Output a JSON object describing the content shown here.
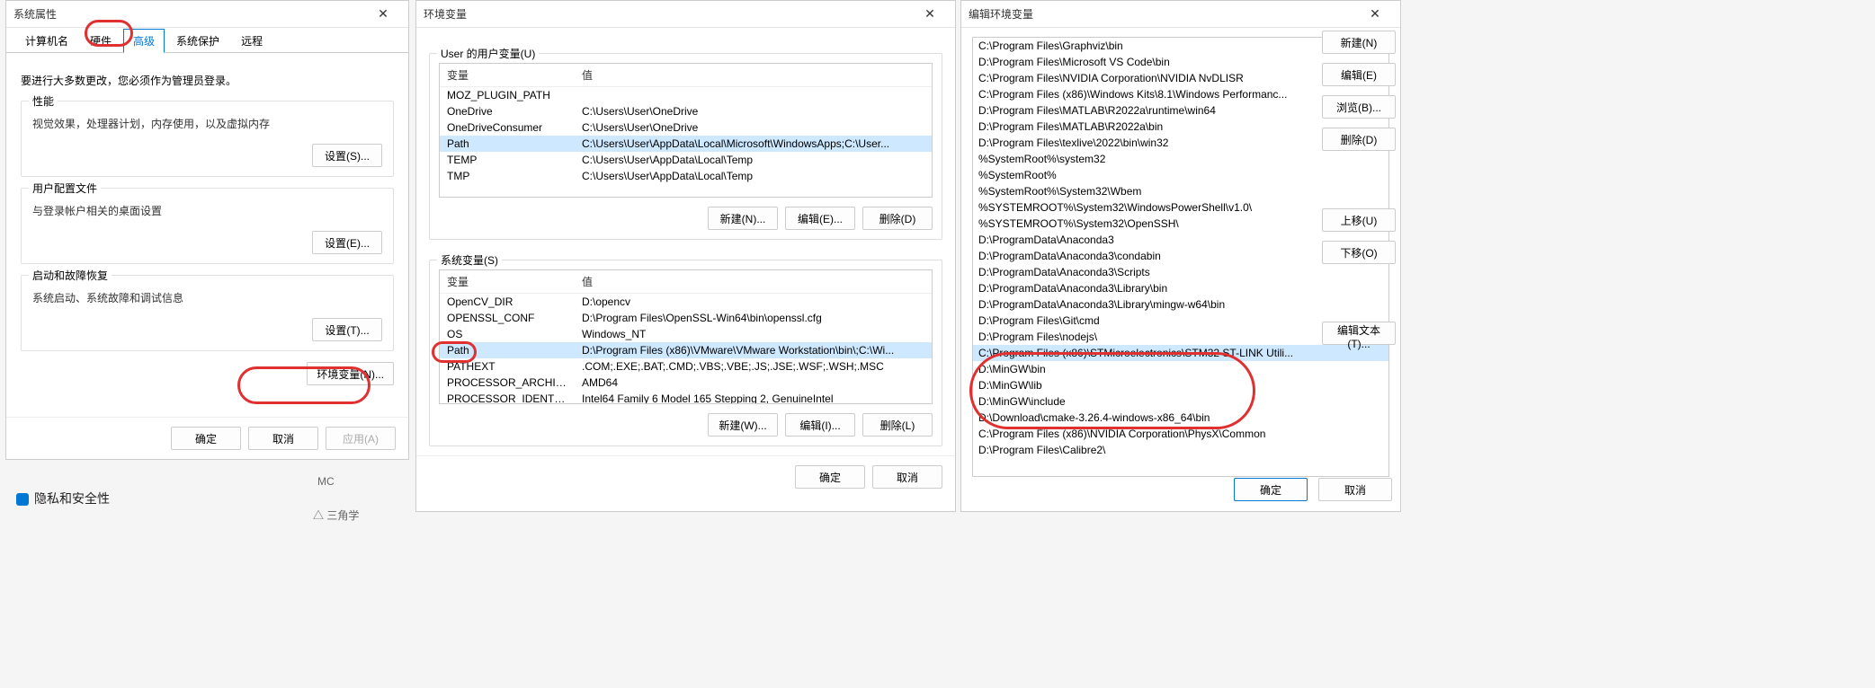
{
  "dlg1": {
    "title": "系统属性",
    "tabs": [
      "计算机名",
      "硬件",
      "高级",
      "系统保护",
      "远程"
    ],
    "active_tab": 2,
    "intro": "要进行大多数更改，您必须作为管理员登录。",
    "g1": {
      "title": "性能",
      "desc": "视觉效果，处理器计划，内存使用，以及虚拟内存",
      "btn": "设置(S)..."
    },
    "g2": {
      "title": "用户配置文件",
      "desc": "与登录帐户相关的桌面设置",
      "btn": "设置(E)..."
    },
    "g3": {
      "title": "启动和故障恢复",
      "desc": "系统启动、系统故障和调试信息",
      "btn": "设置(T)..."
    },
    "envbtn": "环境变量(N)...",
    "ok": "确定",
    "cancel": "取消",
    "apply": "应用(A)"
  },
  "dlg2": {
    "title": "环境变量",
    "user_label": "User 的用户变量(U)",
    "sys_label": "系统变量(S)",
    "col_var": "变量",
    "col_val": "值",
    "user_vars": [
      {
        "name": "MOZ_PLUGIN_PATH",
        "value": ""
      },
      {
        "name": "OneDrive",
        "value": "C:\\Users\\User\\OneDrive"
      },
      {
        "name": "OneDriveConsumer",
        "value": "C:\\Users\\User\\OneDrive"
      },
      {
        "name": "Path",
        "value": "C:\\Users\\User\\AppData\\Local\\Microsoft\\WindowsApps;C:\\User..."
      },
      {
        "name": "TEMP",
        "value": "C:\\Users\\User\\AppData\\Local\\Temp"
      },
      {
        "name": "TMP",
        "value": "C:\\Users\\User\\AppData\\Local\\Temp"
      }
    ],
    "user_selected": 3,
    "sys_vars": [
      {
        "name": "OpenCV_DIR",
        "value": "D:\\opencv"
      },
      {
        "name": "OPENSSL_CONF",
        "value": "D:\\Program Files\\OpenSSL-Win64\\bin\\openssl.cfg"
      },
      {
        "name": "OS",
        "value": "Windows_NT"
      },
      {
        "name": "Path",
        "value": "D:\\Program Files (x86)\\VMware\\VMware Workstation\\bin\\;C:\\Wi..."
      },
      {
        "name": "PATHEXT",
        "value": ".COM;.EXE;.BAT;.CMD;.VBS;.VBE;.JS;.JSE;.WSF;.WSH;.MSC"
      },
      {
        "name": "PROCESSOR_ARCHITECTURE",
        "value": "AMD64"
      },
      {
        "name": "PROCESSOR_IDENTIFIER",
        "value": "Intel64 Family 6 Model 165 Stepping 2, GenuineIntel"
      }
    ],
    "sys_selected": 3,
    "btn_new": "新建(N)...",
    "btn_edit": "编辑(E)...",
    "btn_del": "删除(D)",
    "btn_new2": "新建(W)...",
    "btn_edit2": "编辑(I)...",
    "btn_del2": "删除(L)",
    "ok": "确定",
    "cancel": "取消"
  },
  "dlg3": {
    "title": "编辑环境变量",
    "paths": [
      "C:\\Program Files\\Graphviz\\bin",
      "D:\\Program Files\\Microsoft VS Code\\bin",
      "C:\\Program Files\\NVIDIA Corporation\\NVIDIA NvDLISR",
      "C:\\Program Files (x86)\\Windows Kits\\8.1\\Windows Performanc...",
      "D:\\Program Files\\MATLAB\\R2022a\\runtime\\win64",
      "D:\\Program Files\\MATLAB\\R2022a\\bin",
      "D:\\Program Files\\texlive\\2022\\bin\\win32",
      "%SystemRoot%\\system32",
      "%SystemRoot%",
      "%SystemRoot%\\System32\\Wbem",
      "%SYSTEMROOT%\\System32\\WindowsPowerShell\\v1.0\\",
      "%SYSTEMROOT%\\System32\\OpenSSH\\",
      "D:\\ProgramData\\Anaconda3",
      "D:\\ProgramData\\Anaconda3\\condabin",
      "D:\\ProgramData\\Anaconda3\\Scripts",
      "D:\\ProgramData\\Anaconda3\\Library\\bin",
      "D:\\ProgramData\\Anaconda3\\Library\\mingw-w64\\bin",
      "D:\\Program Files\\Git\\cmd",
      "D:\\Program Files\\nodejs\\",
      "C:\\Program Files (x86)\\STMicroelectronics\\STM32 ST-LINK Utili...",
      "D:\\MinGW\\bin",
      "D:\\MinGW\\lib",
      "D:\\MinGW\\include",
      "D:\\Download\\cmake-3.26.4-windows-x86_64\\bin",
      "C:\\Program Files (x86)\\NVIDIA Corporation\\PhysX\\Common",
      "D:\\Program Files\\Calibre2\\"
    ],
    "highlighted": 19,
    "btn_new": "新建(N)",
    "btn_edit": "编辑(E)",
    "btn_browse": "浏览(B)...",
    "btn_del": "删除(D)",
    "btn_up": "上移(U)",
    "btn_down": "下移(O)",
    "btn_edittext": "编辑文本(T)...",
    "ok": "确定",
    "cancel": "取消"
  },
  "bg": {
    "privacy": "隐私和安全性",
    "mc": "MC",
    "trig": "三角学"
  }
}
